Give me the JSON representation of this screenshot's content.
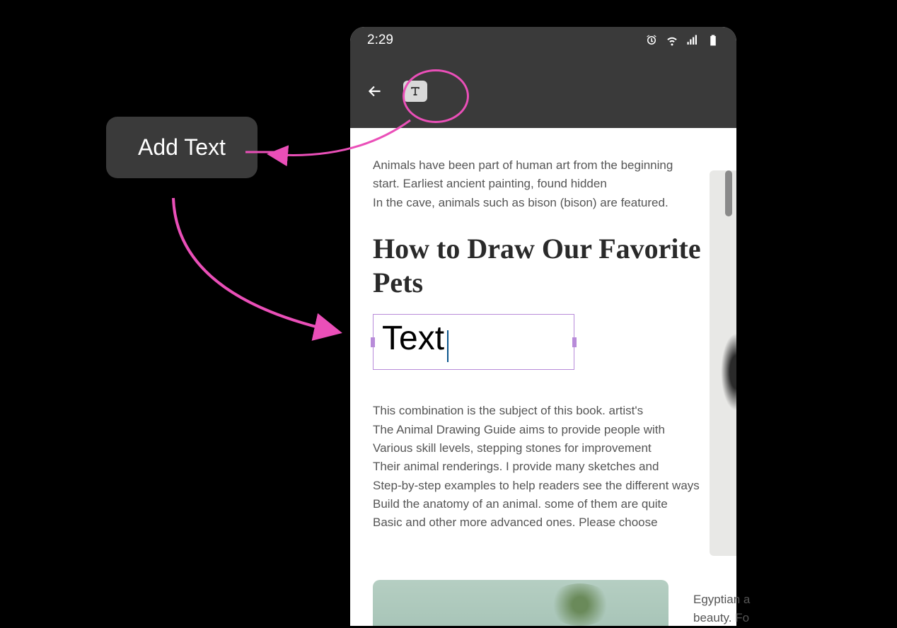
{
  "tooltip": {
    "add_text_label": "Add Text"
  },
  "status_bar": {
    "time": "2:29"
  },
  "document": {
    "para1_line1": "Animals have been part of human art from the beginning",
    "para1_line2": "start. Earliest ancient painting, found hidden",
    "para1_line3": "In the cave, animals such as bison (bison) are featured.",
    "heading": "How to Draw Our Favorite Pets",
    "text_input_value": "Text",
    "para2_line1": "This combination is the subject of this book. artist's",
    "para2_line2": "The Animal Drawing Guide aims to provide people with",
    "para2_line3": "Various skill levels, stepping stones for improvement",
    "para2_line4": "Their animal renderings. I provide many sketches and",
    "para2_line5": "Step-by-step examples to help readers see the different ways",
    "para2_line6": "Build the anatomy of an animal. some of them are quite",
    "para2_line7": "Basic and other more advanced ones. Please choose",
    "right_fragment_line1": "Egyptian a",
    "right_fragment_line2": "beauty. Fo"
  },
  "colors": {
    "highlight_pink": "#ea4fb8",
    "selection_purple": "#b88bd9",
    "toolbar_bg": "#3a3a3a"
  }
}
